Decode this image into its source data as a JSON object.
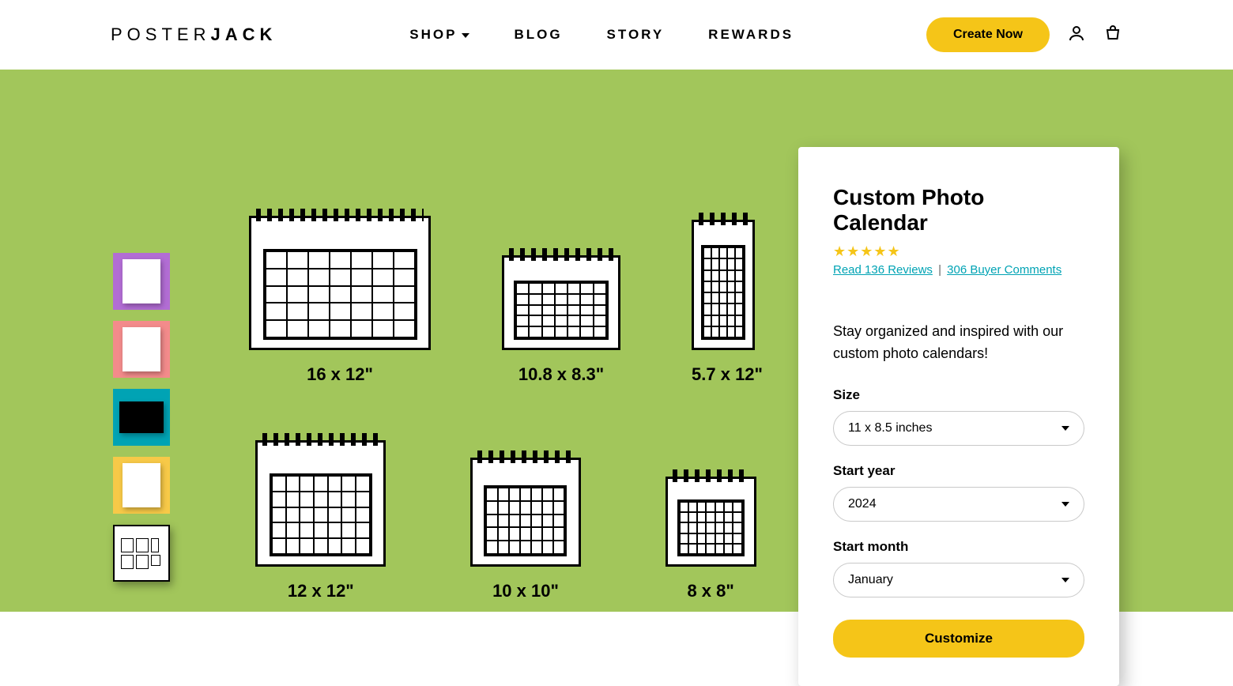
{
  "header": {
    "logo_thin": "POSTER",
    "logo_bold": "JACK",
    "nav": {
      "shop": "SHOP",
      "blog": "BLOG",
      "story": "STORY",
      "rewards": "REWARDS"
    },
    "create_label": "Create Now"
  },
  "sizes": {
    "s1": "16 x 12\"",
    "s2": "10.8 x 8.3\"",
    "s3": "5.7 x 12\"",
    "s4": "12 x 12\"",
    "s5": "10 x 10\"",
    "s6": "8 x 8\""
  },
  "product": {
    "title": "Custom Photo Calendar",
    "reviews_link": "Read 136 Reviews",
    "comments_link": "306 Buyer Comments",
    "description": "Stay organized and inspired with our custom photo calendars!",
    "size_label": "Size",
    "size_value": "11 x 8.5 inches",
    "year_label": "Start year",
    "year_value": "2024",
    "month_label": "Start month",
    "month_value": "January",
    "customize_label": "Customize"
  }
}
